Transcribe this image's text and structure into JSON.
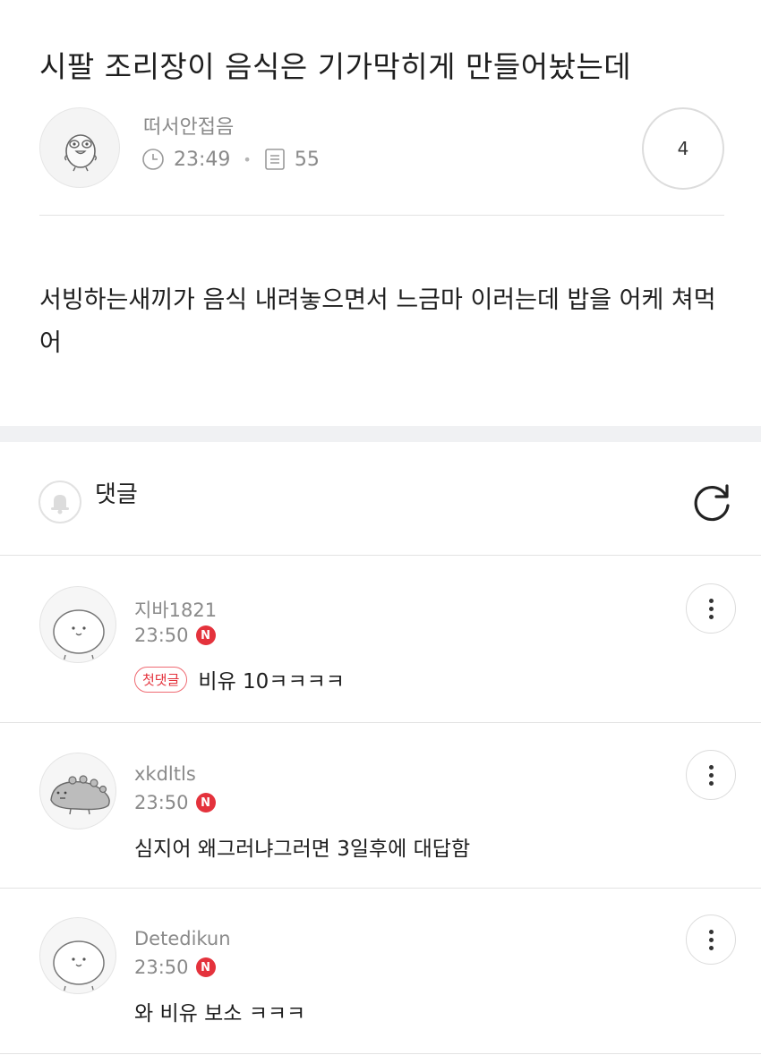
{
  "post": {
    "title": "시팔 조리장이 음식은 기가막히게 만들어놨는데",
    "author": "떠서안접음",
    "time": "23:49",
    "views": "55",
    "likes": "4",
    "body": "서빙하는새끼가 음식 내려놓으면서 느금마 이러는데 밥을 어케 쳐먹어"
  },
  "comments_section": {
    "title": "댓글"
  },
  "comments": [
    {
      "author": "지바1821",
      "time": "23:50",
      "new_badge": "N",
      "first_badge": "첫댓글",
      "text": "비유 10ㅋㅋㅋㅋ"
    },
    {
      "author": "xkdltls",
      "time": "23:50",
      "new_badge": "N",
      "text": "심지어 왜그러냐그러면 3일후에 대답함"
    },
    {
      "author": "Detedikun",
      "time": "23:50",
      "new_badge": "N",
      "text": "와 비유 보소 ㅋㅋㅋ"
    }
  ],
  "colors": {
    "accent_red": "#e4323c",
    "divider": "#e3e3e3",
    "muted_text": "#8a8a8a",
    "section_band": "#f0f1f3"
  },
  "icons": {
    "author_avatar": "bird-character-icon",
    "time": "clock-icon",
    "views": "document-icon",
    "notification": "bell-icon",
    "refresh": "refresh-icon",
    "more": "more-vertical-icon"
  }
}
